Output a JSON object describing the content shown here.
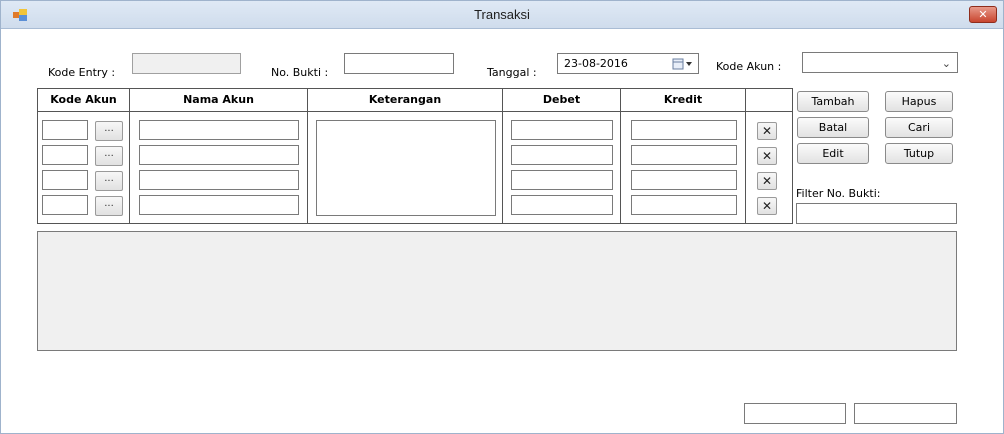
{
  "window": {
    "title": "Transaksi",
    "close_label": "✕"
  },
  "form": {
    "kode_entry_label": "Kode Entry :",
    "kode_entry_value": "",
    "no_bukti_label": "No. Bukti :",
    "no_bukti_value": "",
    "tanggal_label": "Tanggal :",
    "tanggal_value": "23-08-2016",
    "kode_akun_label": "Kode Akun :",
    "kode_akun_value": ""
  },
  "grid": {
    "headers": {
      "kode_akun": "Kode Akun",
      "nama_akun": "Nama Akun",
      "keterangan": "Keterangan",
      "debet": "Debet",
      "kredit": "Kredit"
    },
    "row_button_label": "...",
    "remove_label": "✕",
    "rows": [
      {
        "kode": "",
        "nama": "",
        "debet": "",
        "kredit": ""
      },
      {
        "kode": "",
        "nama": "",
        "debet": "",
        "kredit": ""
      },
      {
        "kode": "",
        "nama": "",
        "debet": "",
        "kredit": ""
      },
      {
        "kode": "",
        "nama": "",
        "debet": "",
        "kredit": ""
      }
    ]
  },
  "buttons": {
    "tambah": "Tambah",
    "hapus": "Hapus",
    "batal": "Batal",
    "cari": "Cari",
    "edit": "Edit",
    "tutup": "Tutup"
  },
  "filter": {
    "label": "Filter No. Bukti:",
    "value": ""
  },
  "colors": {
    "titlebar": "#dfe9f5",
    "close": "#c8452f",
    "panel": "#f0f0f0"
  }
}
